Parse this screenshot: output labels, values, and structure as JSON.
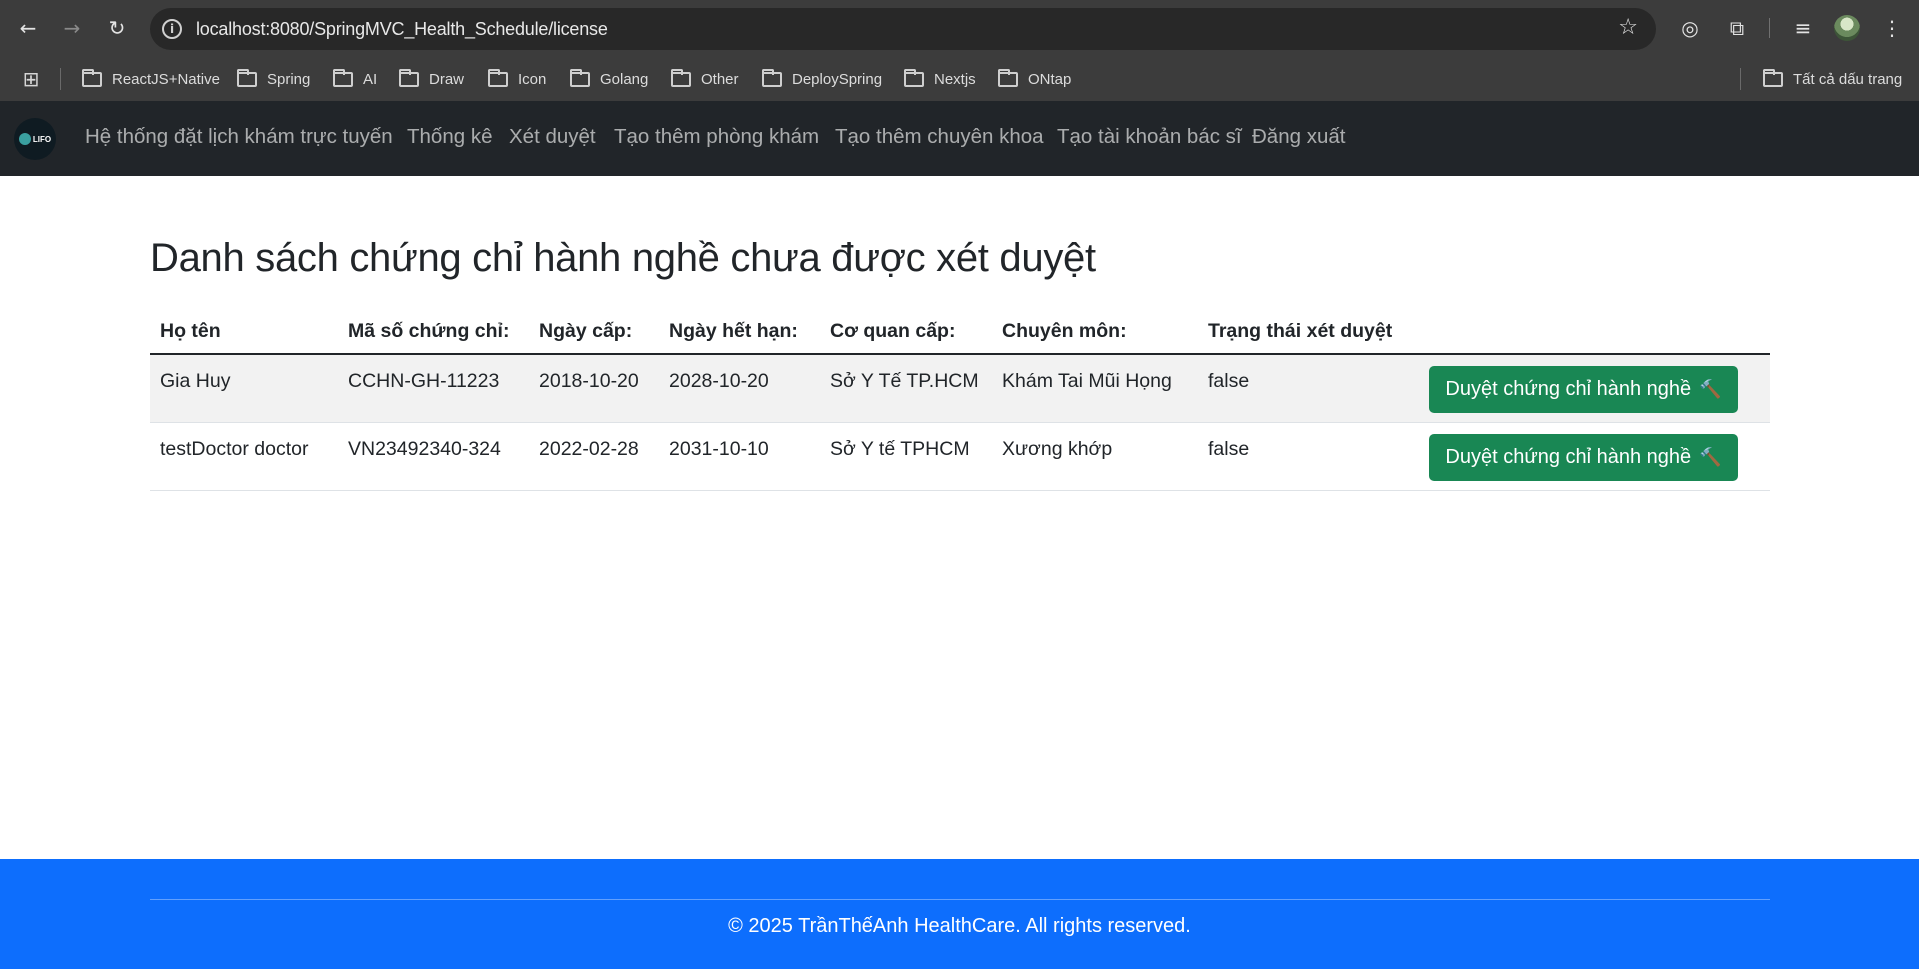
{
  "browser": {
    "url": "localhost:8080/SpringMVC_Health_Schedule/license",
    "icons": {
      "back": "arrow-left-icon",
      "forward": "arrow-right-icon",
      "reload": "reload-icon",
      "site_info": "info-icon",
      "bookmark_star": "star-icon",
      "extensions": "puzzle-icon",
      "menu": "kebab-menu-icon"
    },
    "bookmarks": [
      "ReactJS+Native",
      "Spring",
      "AI",
      "Draw",
      "Icon",
      "Golang",
      "Other",
      "DeploySpring",
      "Nextjs",
      "ONtap"
    ],
    "all_bookmarks_label": "Tất cả dấu trang"
  },
  "navbar": {
    "logo_text": "LIFO",
    "links": [
      "Hệ thống đặt lịch khám trực tuyến",
      "Thống kê",
      "Xét duyệt",
      "Tạo thêm phòng khám",
      "Tạo thêm chuyên khoa",
      "Tạo tài khoản bác sĩ",
      "Đăng xuất"
    ]
  },
  "main": {
    "title": "Danh sách chứng chỉ hành nghề chưa được xét duyệt",
    "table": {
      "headers": [
        "Họ tên",
        "Mã số chứng chỉ:",
        "Ngày cấp:",
        "Ngày hết hạn:",
        "Cơ quan cấp:",
        "Chuyên môn:",
        "Trạng thái xét duyệt"
      ],
      "rows": [
        {
          "name": "Gia Huy",
          "code": "CCHN-GH-11223",
          "issued": "2018-10-20",
          "expires": "2028-10-20",
          "authority": "Sở Y Tế TP.HCM",
          "specialty": "Khám Tai Mũi Họng",
          "status": "false",
          "action": "Duyệt chứng chỉ hành nghề"
        },
        {
          "name": "testDoctor doctor",
          "code": "VN23492340-324",
          "issued": "2022-02-28",
          "expires": "2031-10-10",
          "authority": "Sở Y tế TPHCM",
          "specialty": "Xương khớp",
          "status": "false",
          "action": "Duyệt chứng chỉ hành nghề"
        }
      ],
      "action_icon": "hammer-icon"
    }
  },
  "footer": {
    "text": "© 2025 TrầnThếAnh HealthCare. All rights reserved."
  },
  "colors": {
    "navbar_bg": "#212529",
    "approve_button": "#198754",
    "footer_bg": "#0d6efd"
  }
}
